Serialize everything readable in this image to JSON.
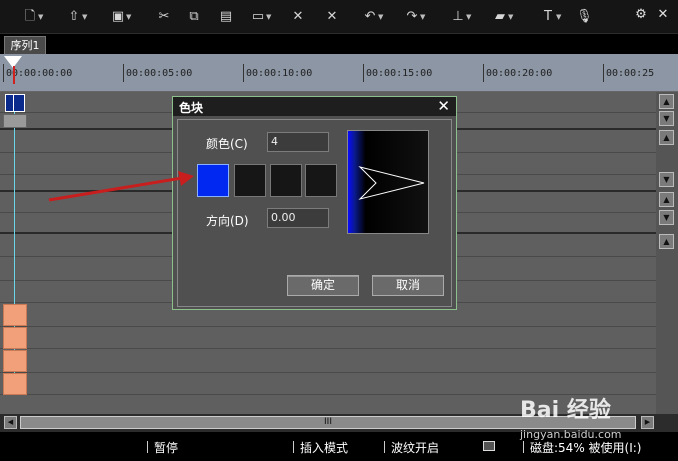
{
  "toolbar": {
    "icons": [
      "new-icon",
      "open-icon",
      "save-icon",
      "cut-icon",
      "copy-icon",
      "paste-icon",
      "link-icon",
      "split-icon",
      "delete-icon",
      "undo-icon",
      "redo-icon",
      "marker-icon",
      "storyboard-icon",
      "text-icon",
      "mic-icon"
    ],
    "right_icons": [
      "settings-icon",
      "close-icon"
    ]
  },
  "tabs": [
    {
      "label": "序列1"
    }
  ],
  "ruler": {
    "ticks": [
      "00:00:00:00",
      "00:00:05:00",
      "00:00:10:00",
      "00:00:15:00",
      "00:00:20:00",
      "00:00:25"
    ]
  },
  "dialog": {
    "title": "色块",
    "color_label": "颜色(C)",
    "color_value": "4",
    "direction_label": "方向(D)",
    "direction_value": "0.00",
    "ok_label": "确定",
    "cancel_label": "取消",
    "swatch_colors": [
      "#0028f0",
      "#161616",
      "#161616",
      "#161616"
    ]
  },
  "hscroll": {
    "thumb_label": "III"
  },
  "statusbar": {
    "pause": "暂停",
    "insert_mode": "插入模式",
    "ripple": "波纹开启",
    "disk": "磁盘:54% 被使用(I:)"
  },
  "watermark": {
    "logo": "Bai 经验",
    "url": "jingyan.baidu.com"
  },
  "colors": {
    "accent_red": "#d02020",
    "selected_swatch": "#0028f0",
    "clip_orange": "#f2a07a",
    "dialog_border": "#8ec08c"
  }
}
